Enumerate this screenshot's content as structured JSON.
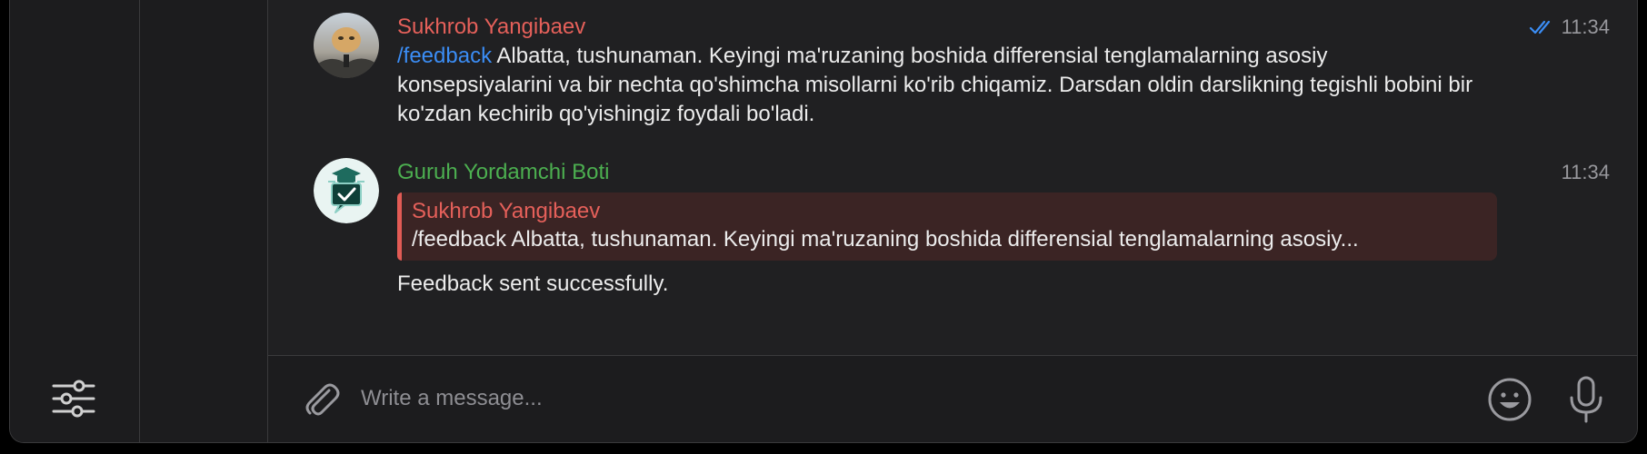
{
  "messages": [
    {
      "sender": "Sukhrob Yangibaev",
      "sender_color": "#e5605a",
      "time": "11:34",
      "read_status": "double-check-icon",
      "command": "/feedback",
      "text": " Albatta, tushunaman. Keyingi ma'ruzaning boshida differensial tenglamalarning asosiy konsepsiyalarini va bir nechta qo'shimcha misollarni ko'rib chiqamiz. Darsdan oldin darslikning tegishli bobini bir ko'zdan kechirib qo'yishingiz foydali bo'ladi."
    },
    {
      "sender": "Guruh Yordamchi Boti",
      "sender_color": "#4caf50",
      "time": "11:34",
      "reply": {
        "name": "Sukhrob Yangibaev",
        "text": "/feedback Albatta, tushunaman. Keyingi ma'ruzaning boshida differensial tenglamalarning asosiy..."
      },
      "text": "Feedback sent successfully."
    }
  ],
  "composer": {
    "placeholder": "Write a message..."
  },
  "colors": {
    "accent": "#3b8df5",
    "reply_bg": "#3b2424",
    "reply_bar": "#e25b55"
  }
}
